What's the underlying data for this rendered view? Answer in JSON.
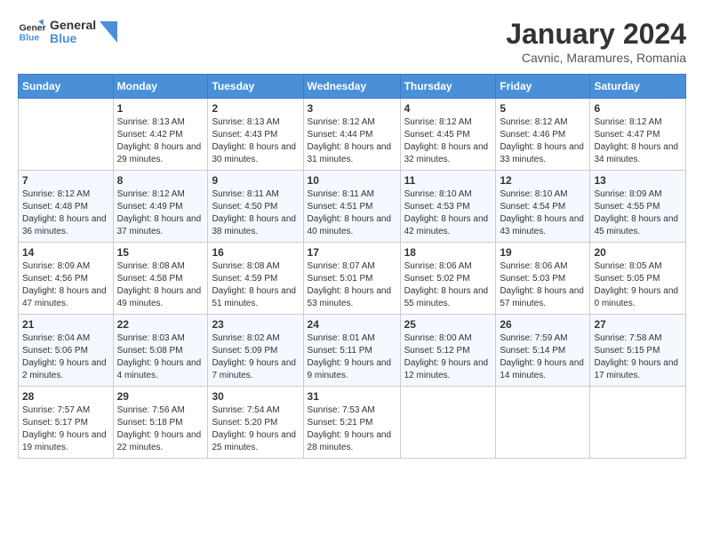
{
  "header": {
    "logo_line1": "General",
    "logo_line2": "Blue",
    "month_year": "January 2024",
    "location": "Cavnic, Maramures, Romania"
  },
  "days_of_week": [
    "Sunday",
    "Monday",
    "Tuesday",
    "Wednesday",
    "Thursday",
    "Friday",
    "Saturday"
  ],
  "weeks": [
    [
      {
        "day": "",
        "sunrise": "",
        "sunset": "",
        "daylight": ""
      },
      {
        "day": "1",
        "sunrise": "Sunrise: 8:13 AM",
        "sunset": "Sunset: 4:42 PM",
        "daylight": "Daylight: 8 hours and 29 minutes."
      },
      {
        "day": "2",
        "sunrise": "Sunrise: 8:13 AM",
        "sunset": "Sunset: 4:43 PM",
        "daylight": "Daylight: 8 hours and 30 minutes."
      },
      {
        "day": "3",
        "sunrise": "Sunrise: 8:12 AM",
        "sunset": "Sunset: 4:44 PM",
        "daylight": "Daylight: 8 hours and 31 minutes."
      },
      {
        "day": "4",
        "sunrise": "Sunrise: 8:12 AM",
        "sunset": "Sunset: 4:45 PM",
        "daylight": "Daylight: 8 hours and 32 minutes."
      },
      {
        "day": "5",
        "sunrise": "Sunrise: 8:12 AM",
        "sunset": "Sunset: 4:46 PM",
        "daylight": "Daylight: 8 hours and 33 minutes."
      },
      {
        "day": "6",
        "sunrise": "Sunrise: 8:12 AM",
        "sunset": "Sunset: 4:47 PM",
        "daylight": "Daylight: 8 hours and 34 minutes."
      }
    ],
    [
      {
        "day": "7",
        "sunrise": "Sunrise: 8:12 AM",
        "sunset": "Sunset: 4:48 PM",
        "daylight": "Daylight: 8 hours and 36 minutes."
      },
      {
        "day": "8",
        "sunrise": "Sunrise: 8:12 AM",
        "sunset": "Sunset: 4:49 PM",
        "daylight": "Daylight: 8 hours and 37 minutes."
      },
      {
        "day": "9",
        "sunrise": "Sunrise: 8:11 AM",
        "sunset": "Sunset: 4:50 PM",
        "daylight": "Daylight: 8 hours and 38 minutes."
      },
      {
        "day": "10",
        "sunrise": "Sunrise: 8:11 AM",
        "sunset": "Sunset: 4:51 PM",
        "daylight": "Daylight: 8 hours and 40 minutes."
      },
      {
        "day": "11",
        "sunrise": "Sunrise: 8:10 AM",
        "sunset": "Sunset: 4:53 PM",
        "daylight": "Daylight: 8 hours and 42 minutes."
      },
      {
        "day": "12",
        "sunrise": "Sunrise: 8:10 AM",
        "sunset": "Sunset: 4:54 PM",
        "daylight": "Daylight: 8 hours and 43 minutes."
      },
      {
        "day": "13",
        "sunrise": "Sunrise: 8:09 AM",
        "sunset": "Sunset: 4:55 PM",
        "daylight": "Daylight: 8 hours and 45 minutes."
      }
    ],
    [
      {
        "day": "14",
        "sunrise": "Sunrise: 8:09 AM",
        "sunset": "Sunset: 4:56 PM",
        "daylight": "Daylight: 8 hours and 47 minutes."
      },
      {
        "day": "15",
        "sunrise": "Sunrise: 8:08 AM",
        "sunset": "Sunset: 4:58 PM",
        "daylight": "Daylight: 8 hours and 49 minutes."
      },
      {
        "day": "16",
        "sunrise": "Sunrise: 8:08 AM",
        "sunset": "Sunset: 4:59 PM",
        "daylight": "Daylight: 8 hours and 51 minutes."
      },
      {
        "day": "17",
        "sunrise": "Sunrise: 8:07 AM",
        "sunset": "Sunset: 5:01 PM",
        "daylight": "Daylight: 8 hours and 53 minutes."
      },
      {
        "day": "18",
        "sunrise": "Sunrise: 8:06 AM",
        "sunset": "Sunset: 5:02 PM",
        "daylight": "Daylight: 8 hours and 55 minutes."
      },
      {
        "day": "19",
        "sunrise": "Sunrise: 8:06 AM",
        "sunset": "Sunset: 5:03 PM",
        "daylight": "Daylight: 8 hours and 57 minutes."
      },
      {
        "day": "20",
        "sunrise": "Sunrise: 8:05 AM",
        "sunset": "Sunset: 5:05 PM",
        "daylight": "Daylight: 9 hours and 0 minutes."
      }
    ],
    [
      {
        "day": "21",
        "sunrise": "Sunrise: 8:04 AM",
        "sunset": "Sunset: 5:06 PM",
        "daylight": "Daylight: 9 hours and 2 minutes."
      },
      {
        "day": "22",
        "sunrise": "Sunrise: 8:03 AM",
        "sunset": "Sunset: 5:08 PM",
        "daylight": "Daylight: 9 hours and 4 minutes."
      },
      {
        "day": "23",
        "sunrise": "Sunrise: 8:02 AM",
        "sunset": "Sunset: 5:09 PM",
        "daylight": "Daylight: 9 hours and 7 minutes."
      },
      {
        "day": "24",
        "sunrise": "Sunrise: 8:01 AM",
        "sunset": "Sunset: 5:11 PM",
        "daylight": "Daylight: 9 hours and 9 minutes."
      },
      {
        "day": "25",
        "sunrise": "Sunrise: 8:00 AM",
        "sunset": "Sunset: 5:12 PM",
        "daylight": "Daylight: 9 hours and 12 minutes."
      },
      {
        "day": "26",
        "sunrise": "Sunrise: 7:59 AM",
        "sunset": "Sunset: 5:14 PM",
        "daylight": "Daylight: 9 hours and 14 minutes."
      },
      {
        "day": "27",
        "sunrise": "Sunrise: 7:58 AM",
        "sunset": "Sunset: 5:15 PM",
        "daylight": "Daylight: 9 hours and 17 minutes."
      }
    ],
    [
      {
        "day": "28",
        "sunrise": "Sunrise: 7:57 AM",
        "sunset": "Sunset: 5:17 PM",
        "daylight": "Daylight: 9 hours and 19 minutes."
      },
      {
        "day": "29",
        "sunrise": "Sunrise: 7:56 AM",
        "sunset": "Sunset: 5:18 PM",
        "daylight": "Daylight: 9 hours and 22 minutes."
      },
      {
        "day": "30",
        "sunrise": "Sunrise: 7:54 AM",
        "sunset": "Sunset: 5:20 PM",
        "daylight": "Daylight: 9 hours and 25 minutes."
      },
      {
        "day": "31",
        "sunrise": "Sunrise: 7:53 AM",
        "sunset": "Sunset: 5:21 PM",
        "daylight": "Daylight: 9 hours and 28 minutes."
      },
      {
        "day": "",
        "sunrise": "",
        "sunset": "",
        "daylight": ""
      },
      {
        "day": "",
        "sunrise": "",
        "sunset": "",
        "daylight": ""
      },
      {
        "day": "",
        "sunrise": "",
        "sunset": "",
        "daylight": ""
      }
    ]
  ]
}
